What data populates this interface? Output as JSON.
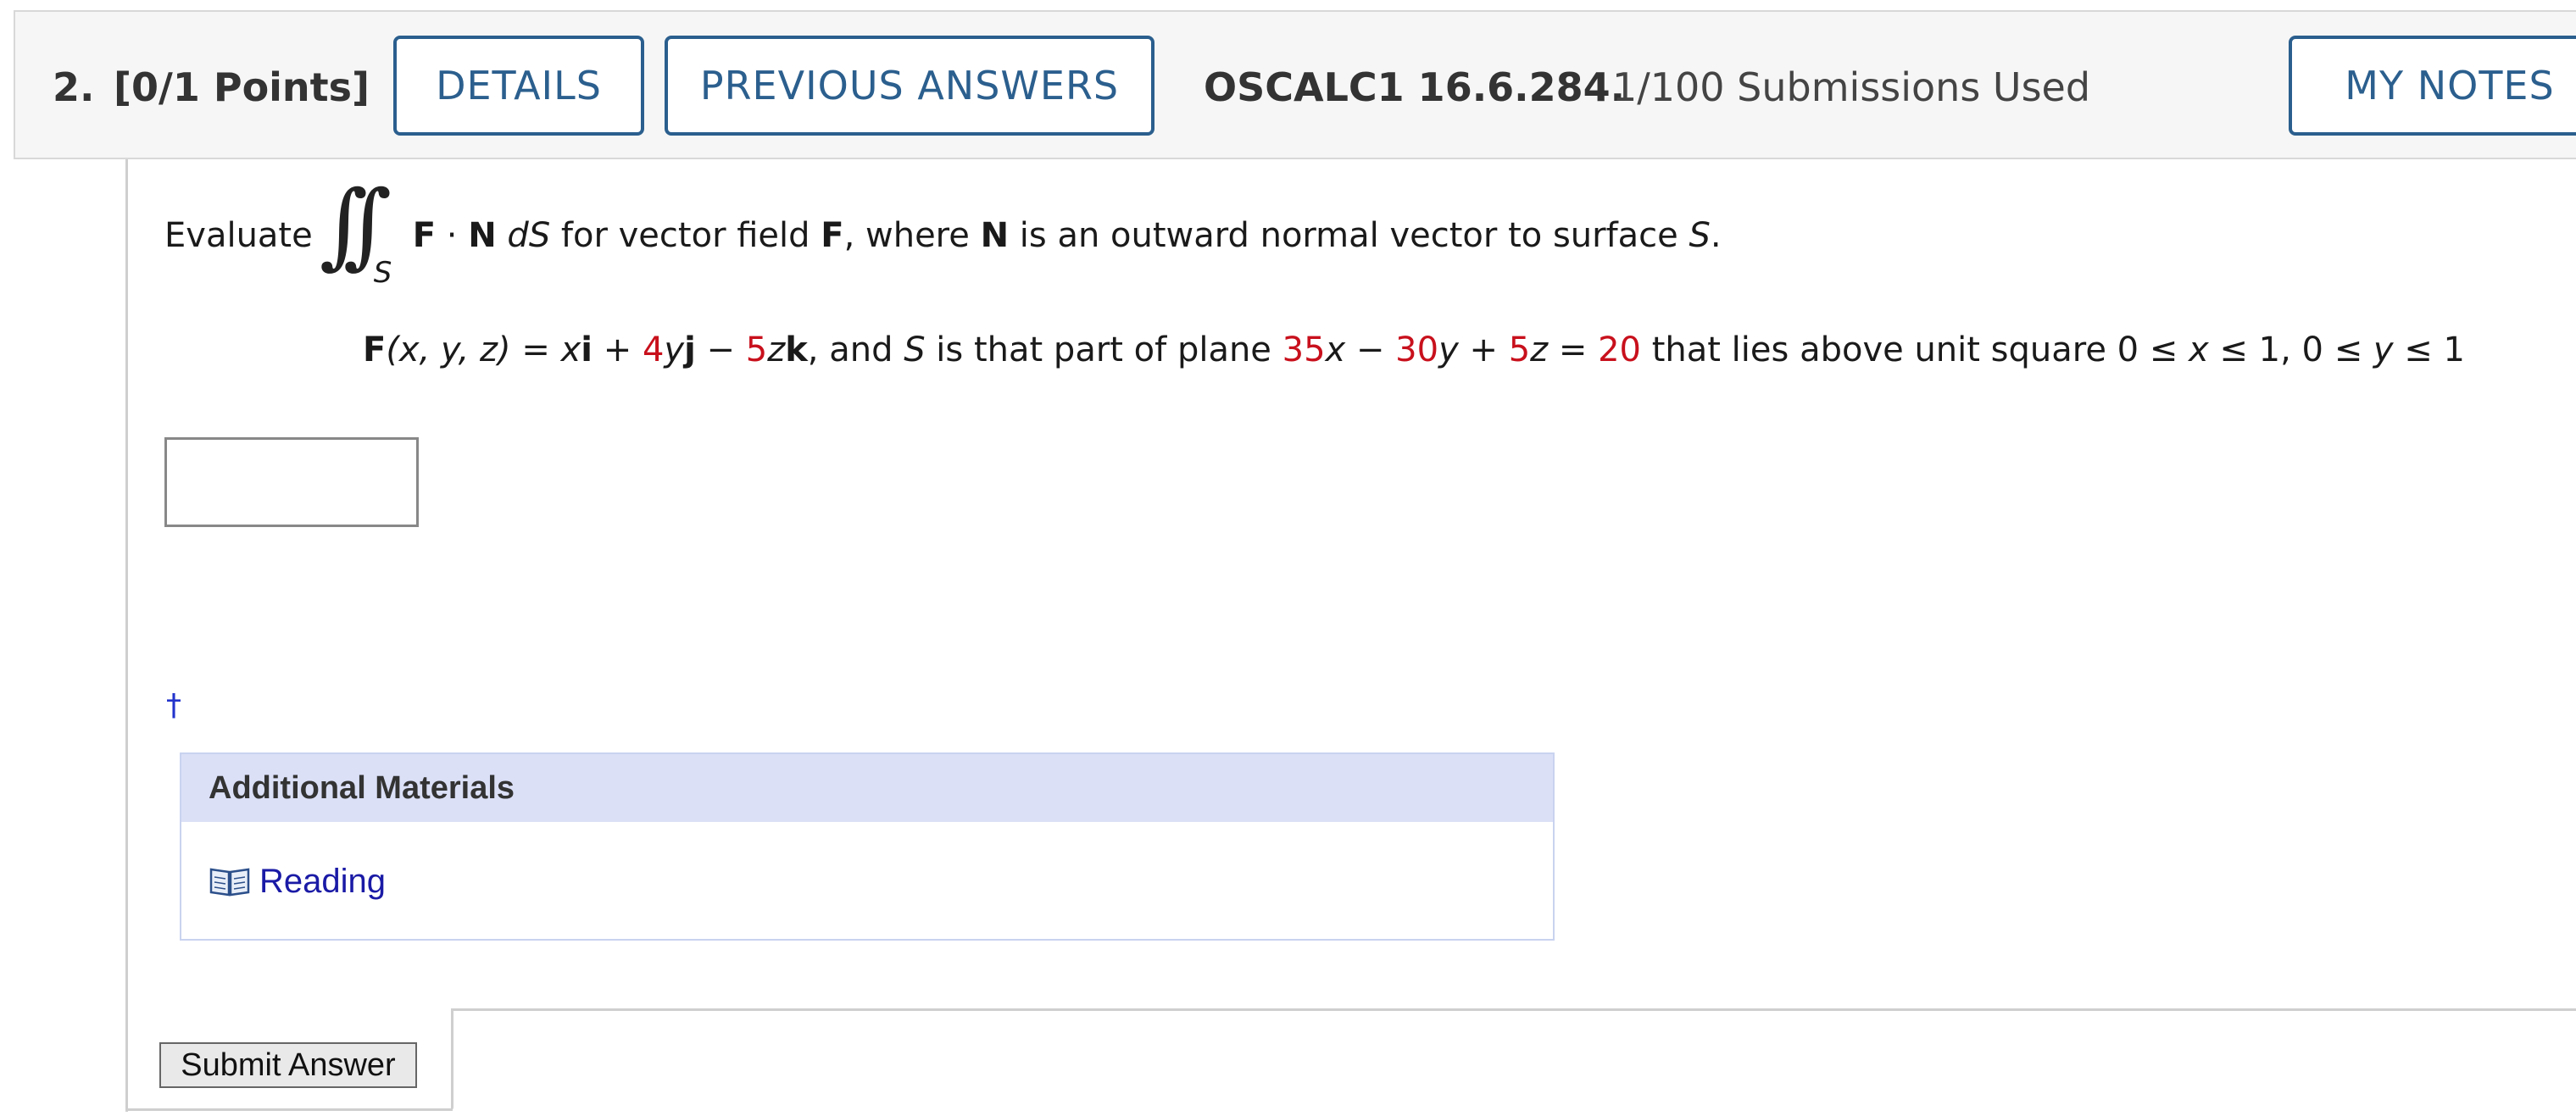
{
  "header": {
    "number": "2.",
    "points": "[0/1 Points]",
    "details_label": "DETAILS",
    "previous_answers_label": "PREVIOUS ANSWERS",
    "problem_code": "OSCALC1 16.6.284.",
    "submissions": "1/100 Submissions Used",
    "my_notes_label": "MY NOTES"
  },
  "question": {
    "evaluate_word": "Evaluate",
    "integral_subscript": "S",
    "prompt": {
      "F": "F",
      "dot": " · ",
      "N": "N",
      "dS": "dS",
      "t1": " for vector field ",
      "F2": "F",
      "t2": ", where ",
      "N2": "N",
      "t3": " is an outward normal vector to surface ",
      "S": "S",
      "period": "."
    },
    "field_line": {
      "F": "F",
      "args": "(x, y, z)",
      "eq": " = ",
      "x": "x",
      "i": "i",
      "plus1": " + ",
      "c4": "4",
      "y": "y",
      "j": "j",
      "minus1": " − ",
      "c5": "5",
      "z": "z",
      "k": "k",
      "t_and": ", and ",
      "S": "S",
      "t_part": " is that part of plane ",
      "p35": "35",
      "px": "x",
      "pminus": " − ",
      "p30": "30",
      "py": "y",
      "pplus": " + ",
      "p5": "5",
      "pz": "z",
      "peq": " = ",
      "p20": "20",
      "t_lies": " that lies above unit square 0 ≤ ",
      "ux": "x",
      "t_mid": " ≤ 1, 0 ≤ ",
      "uy": "y",
      "t_end": " ≤ 1"
    },
    "answer_value": "",
    "dagger": "†"
  },
  "additional_materials": {
    "title": "Additional Materials",
    "reading_label": "Reading",
    "icon": "book-icon"
  },
  "submit_label": "Submit Answer",
  "colors": {
    "accent": "#2b5f8e",
    "highlight_number": "#c8101c",
    "link": "#1a1aa6",
    "materials_header": "#dbe0f7"
  }
}
